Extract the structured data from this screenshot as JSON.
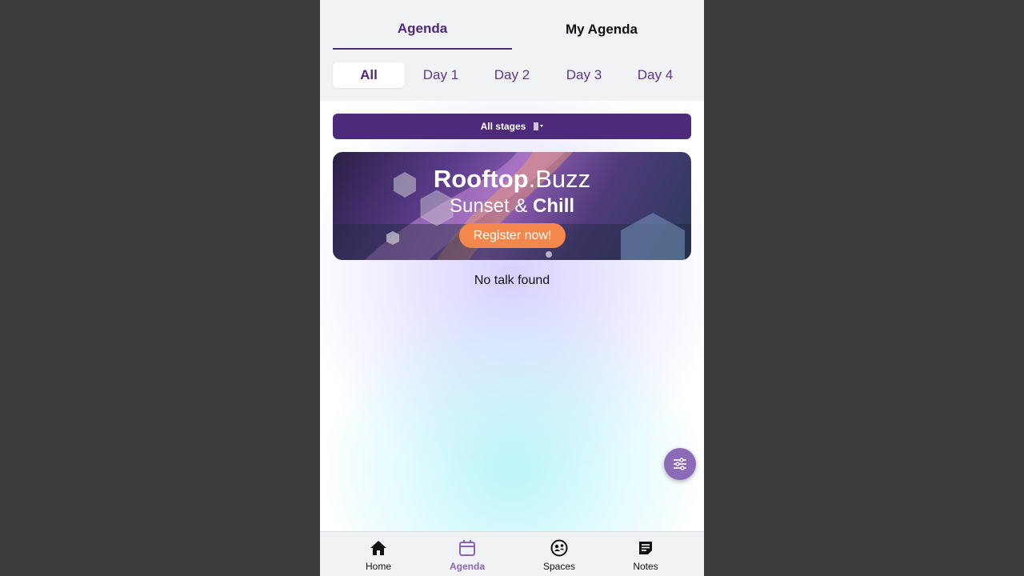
{
  "tabs": [
    {
      "label": "Agenda",
      "active": true
    },
    {
      "label": "My Agenda",
      "active": false
    }
  ],
  "days": [
    {
      "label": "All",
      "active": true
    },
    {
      "label": "Day 1"
    },
    {
      "label": "Day 2"
    },
    {
      "label": "Day 3"
    },
    {
      "label": "Day 4"
    }
  ],
  "filter": {
    "stages_label": "All stages"
  },
  "banner": {
    "title_bold": "Rooftop",
    "title_rest": ".Buzz",
    "sub_regular": "Sunset & ",
    "sub_bold": "Chill",
    "cta": "Register now!"
  },
  "empty_message": "No talk found",
  "nav": [
    {
      "label": "Home",
      "icon": "home-icon"
    },
    {
      "label": "Agenda",
      "icon": "calendar-icon",
      "active": true
    },
    {
      "label": "Spaces",
      "icon": "spaces-icon"
    },
    {
      "label": "Notes",
      "icon": "notes-icon"
    }
  ],
  "colors": {
    "primary": "#4d2a7a",
    "accent": "#f4874b",
    "fab": "#8b6bb8",
    "nav_active": "#8a66b5"
  }
}
